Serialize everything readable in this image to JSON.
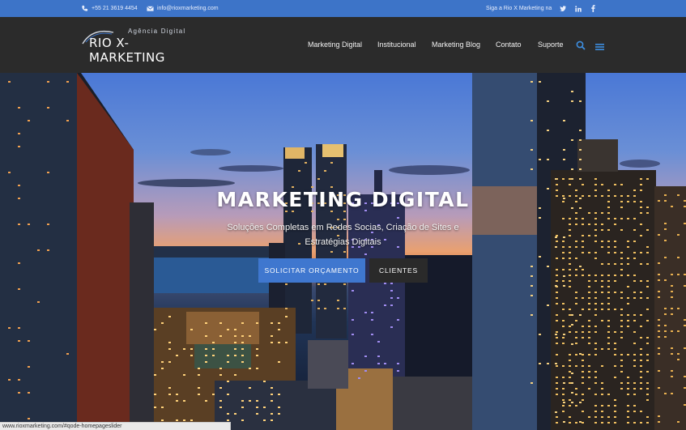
{
  "topbar": {
    "phone": "+55 21 3619 4454",
    "email": "info@rioxmarketing.com",
    "follow_text": "Siga a Rio X Marketing na",
    "social": [
      "twitter-icon",
      "linkedin-icon",
      "facebook-icon"
    ]
  },
  "logo": {
    "tagline": "Agência Digital",
    "name": "RIO X-MARKETING"
  },
  "nav": {
    "items": [
      "Marketing Digital",
      "Institucional",
      "Marketing Blog",
      "Contato",
      "Suporte"
    ]
  },
  "hero": {
    "title": "MARKETING DIGITAL",
    "subtitle": "Soluções Completas em Redes Socias, Criação de Sites e Estratégias Digitais",
    "primary_button": "SOLICITAR ORÇAMENTO",
    "secondary_button": "CLIENTES"
  },
  "statusbar": {
    "url": "www.rioxmarketing.com/#qode-homepageslider"
  },
  "colors": {
    "accent": "#3d74c8",
    "header_bg": "#2b2b2b",
    "secondary_button": "#2a2a2a"
  }
}
